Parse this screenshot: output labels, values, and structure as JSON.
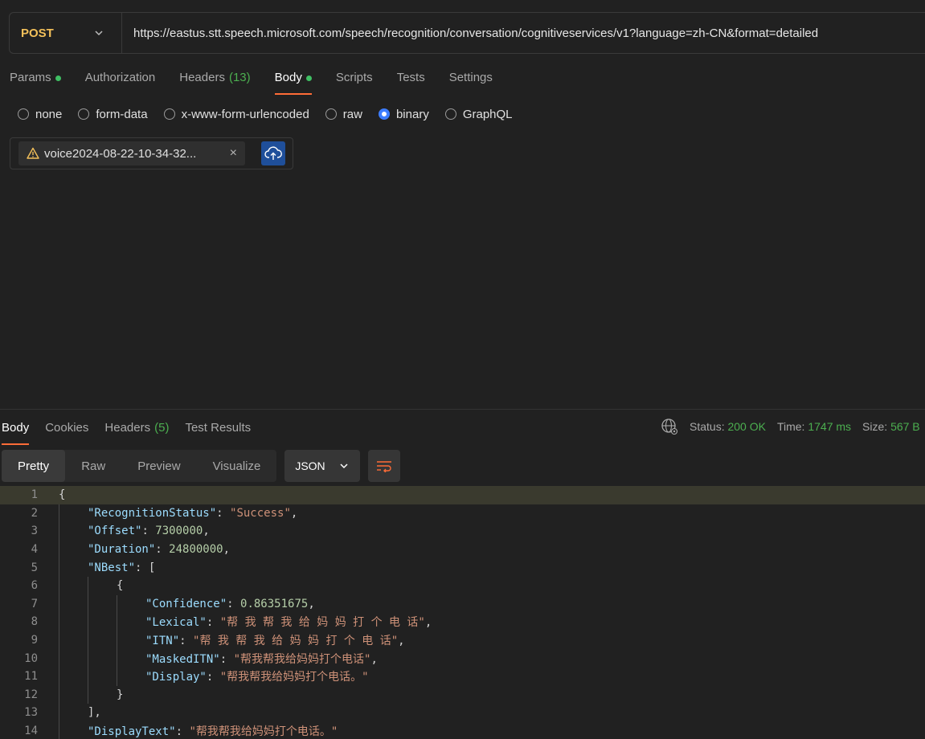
{
  "request": {
    "method": "POST",
    "url": "https://eastus.stt.speech.microsoft.com/speech/recognition/conversation/cognitiveservices/v1?language=zh-CN&format=detailed"
  },
  "req_tabs": [
    {
      "label": "Params",
      "count": "",
      "dot": true,
      "active": false
    },
    {
      "label": "Authorization",
      "count": "",
      "dot": false,
      "active": false
    },
    {
      "label": "Headers",
      "count": "(13)",
      "dot": false,
      "active": false
    },
    {
      "label": "Body",
      "count": "",
      "dot": true,
      "active": true
    },
    {
      "label": "Scripts",
      "count": "",
      "dot": false,
      "active": false
    },
    {
      "label": "Tests",
      "count": "",
      "dot": false,
      "active": false
    },
    {
      "label": "Settings",
      "count": "",
      "dot": false,
      "active": false
    }
  ],
  "body_types": [
    {
      "label": "none",
      "checked": false
    },
    {
      "label": "form-data",
      "checked": false
    },
    {
      "label": "x-www-form-urlencoded",
      "checked": false
    },
    {
      "label": "raw",
      "checked": false
    },
    {
      "label": "binary",
      "checked": true
    },
    {
      "label": "GraphQL",
      "checked": false
    }
  ],
  "file": {
    "name": "voice2024-08-22-10-34-32...",
    "close": "×"
  },
  "resp_tabs": [
    {
      "label": "Body",
      "count": "",
      "active": true
    },
    {
      "label": "Cookies",
      "count": "",
      "active": false
    },
    {
      "label": "Headers",
      "count": "(5)",
      "active": false
    },
    {
      "label": "Test Results",
      "count": "",
      "active": false
    }
  ],
  "status": {
    "status_label": "Status:",
    "status_value": "200 OK",
    "time_label": "Time:",
    "time_value": "1747 ms",
    "size_label": "Size:",
    "size_value": "567 B"
  },
  "view_modes": [
    {
      "label": "Pretty",
      "active": true
    },
    {
      "label": "Raw",
      "active": false
    },
    {
      "label": "Preview",
      "active": false
    },
    {
      "label": "Visualize",
      "active": false
    }
  ],
  "format": "JSON",
  "code_lines": [
    {
      "n": "1",
      "indent": 0,
      "parts": [
        [
          "p",
          "{"
        ]
      ],
      "hl": true
    },
    {
      "n": "2",
      "indent": 1,
      "parts": [
        [
          "k",
          "\"RecognitionStatus\""
        ],
        [
          "p",
          ": "
        ],
        [
          "s",
          "\"Success\""
        ],
        [
          "p",
          ","
        ]
      ]
    },
    {
      "n": "3",
      "indent": 1,
      "parts": [
        [
          "k",
          "\"Offset\""
        ],
        [
          "p",
          ": "
        ],
        [
          "n",
          "7300000"
        ],
        [
          "p",
          ","
        ]
      ]
    },
    {
      "n": "4",
      "indent": 1,
      "parts": [
        [
          "k",
          "\"Duration\""
        ],
        [
          "p",
          ": "
        ],
        [
          "n",
          "24800000"
        ],
        [
          "p",
          ","
        ]
      ]
    },
    {
      "n": "5",
      "indent": 1,
      "parts": [
        [
          "k",
          "\"NBest\""
        ],
        [
          "p",
          ": ["
        ]
      ]
    },
    {
      "n": "6",
      "indent": 2,
      "parts": [
        [
          "p",
          "{"
        ]
      ]
    },
    {
      "n": "7",
      "indent": 3,
      "parts": [
        [
          "k",
          "\"Confidence\""
        ],
        [
          "p",
          ": "
        ],
        [
          "n",
          "0.86351675"
        ],
        [
          "p",
          ","
        ]
      ]
    },
    {
      "n": "8",
      "indent": 3,
      "parts": [
        [
          "k",
          "\"Lexical\""
        ],
        [
          "p",
          ": "
        ],
        [
          "s",
          "\"帮 我 帮 我 给 妈 妈 打 个 电 话\""
        ],
        [
          "p",
          ","
        ]
      ]
    },
    {
      "n": "9",
      "indent": 3,
      "parts": [
        [
          "k",
          "\"ITN\""
        ],
        [
          "p",
          ": "
        ],
        [
          "s",
          "\"帮 我 帮 我 给 妈 妈 打 个 电 话\""
        ],
        [
          "p",
          ","
        ]
      ]
    },
    {
      "n": "10",
      "indent": 3,
      "parts": [
        [
          "k",
          "\"MaskedITN\""
        ],
        [
          "p",
          ": "
        ],
        [
          "s",
          "\"帮我帮我给妈妈打个电话\""
        ],
        [
          "p",
          ","
        ]
      ]
    },
    {
      "n": "11",
      "indent": 3,
      "parts": [
        [
          "k",
          "\"Display\""
        ],
        [
          "p",
          ": "
        ],
        [
          "s",
          "\"帮我帮我给妈妈打个电话。\""
        ]
      ]
    },
    {
      "n": "12",
      "indent": 2,
      "parts": [
        [
          "p",
          "}"
        ]
      ]
    },
    {
      "n": "13",
      "indent": 1,
      "parts": [
        [
          "p",
          "],"
        ]
      ]
    },
    {
      "n": "14",
      "indent": 1,
      "parts": [
        [
          "k",
          "\"DisplayText\""
        ],
        [
          "p",
          ": "
        ],
        [
          "s",
          "\"帮我帮我给妈妈打个电话。\""
        ]
      ]
    }
  ]
}
